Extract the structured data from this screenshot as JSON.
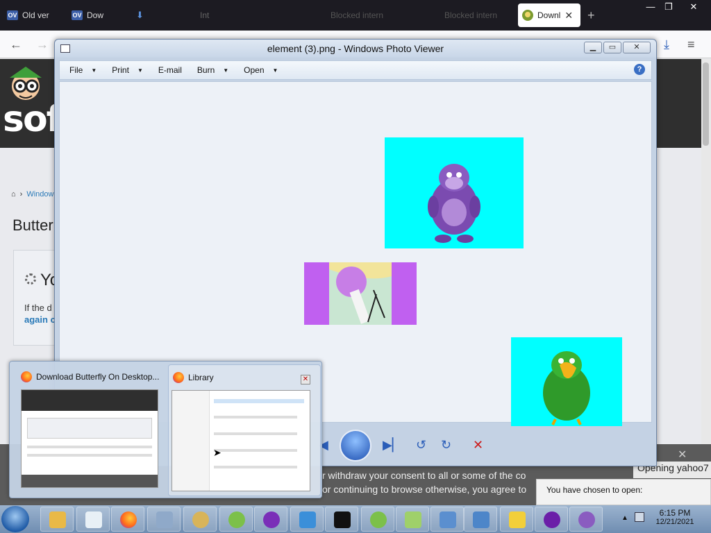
{
  "browser": {
    "tabs": [
      {
        "label": "Old ver",
        "icon": "ov-icon"
      },
      {
        "label": "Dow",
        "icon": "ov-icon"
      },
      {
        "label": "",
        "icon": "download-icon"
      },
      {
        "label": "Int",
        "icon": ""
      },
      {
        "label": "Blocked intern",
        "icon": ""
      },
      {
        "label": "",
        "icon": ""
      },
      {
        "label": "Blocked intern",
        "icon": ""
      }
    ],
    "active_tab": "Downl",
    "new_tab_symbol": "+"
  },
  "website": {
    "logo_text": "soft",
    "breadcrumb": "Window",
    "heading": "Butter",
    "download_box": {
      "title": "Yo",
      "text1": "If the d",
      "text2": "again c"
    }
  },
  "photo_viewer": {
    "title": "element (3).png - Windows Photo Viewer",
    "menu": [
      "File",
      "Print",
      "E-mail",
      "Burn",
      "Open"
    ],
    "help": "?",
    "images": [
      {
        "name": "purple-gorilla-image",
        "bg": "#00ffff"
      },
      {
        "name": "lollipop-character-image",
        "bg": "#c060f0"
      },
      {
        "name": "green-parrot-image",
        "bg": "#00ffff"
      }
    ]
  },
  "cookie_bar": {
    "line1": "r withdraw your consent to all or some of the co",
    "line2": "or continuing to browse otherwise, you agree to",
    "opening": "Opening yahoo7",
    "chosen": "You have chosen to open:"
  },
  "previews": {
    "left_title": "Download Butterfly On Desktop...",
    "right_title": "Library"
  },
  "taskbar": {
    "time": "6:15 PM",
    "date": "12/21/2021"
  }
}
